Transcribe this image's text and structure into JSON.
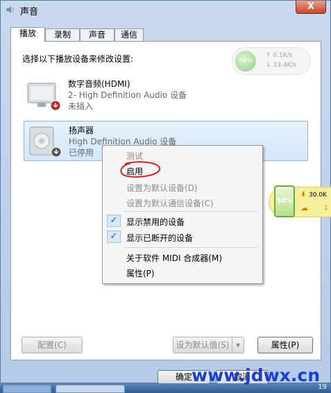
{
  "window": {
    "title": "声音",
    "close_label": "X"
  },
  "tabs": [
    {
      "label": "播放",
      "active": true
    },
    {
      "label": "录制"
    },
    {
      "label": "声音"
    },
    {
      "label": "通信"
    }
  ],
  "instruction": "选择以下播放设备来修改设置:",
  "net_monitor": {
    "percent": "54%",
    "up": "0.1K/s",
    "down": "33.4K/s"
  },
  "devices": [
    {
      "name": "数字音频(HDMI)",
      "desc": "2- High Definition Audio 设备",
      "status": "未插入",
      "icon": "monitor-icon"
    },
    {
      "name": "扬声器",
      "desc": "High Definition Audio 设备",
      "status": "已停用",
      "icon": "speaker-icon",
      "selected": true
    }
  ],
  "context_menu": {
    "items": [
      {
        "label": "测试",
        "disabled": true
      },
      {
        "label": "启用"
      },
      {
        "label": "设置为默认设备(D)",
        "disabled": true
      },
      {
        "label": "设置为默认通信设备(C)",
        "disabled": true
      },
      {
        "label": "显示禁用的设备",
        "checked": true
      },
      {
        "label": "显示已断开的设备",
        "checked": true
      },
      {
        "label": "关于软件 MIDI 合成器(M)"
      },
      {
        "label": "属性(P)"
      }
    ]
  },
  "gadget": {
    "percent": "50%",
    "speed": "30.0K",
    "count": "1"
  },
  "buttons": {
    "configure": "配置(C)",
    "set_default": "设为默认值(S)",
    "properties": "属性(P)",
    "ok": "确定",
    "cancel": "取消"
  },
  "watermark": "www.jdwx.cn",
  "taskbar": {
    "number": "19"
  },
  "colors": {
    "selection": "#d3e6fb",
    "annotation_red": "#d9201a",
    "watermark": "#1a3fd0"
  }
}
